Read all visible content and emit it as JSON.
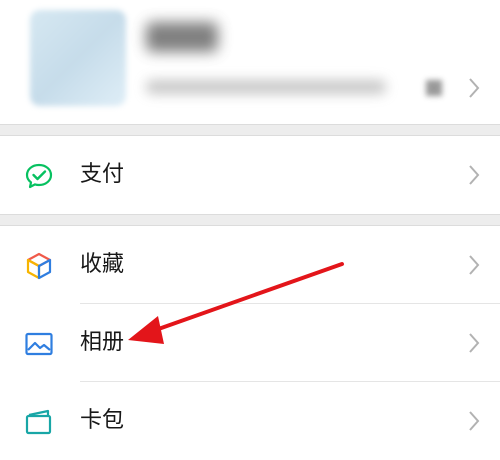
{
  "menu": {
    "items": [
      {
        "label": "支付",
        "icon": "wechat-pay-icon"
      },
      {
        "label": "收藏",
        "icon": "favorites-cube-icon"
      },
      {
        "label": "相册",
        "icon": "album-picture-icon"
      },
      {
        "label": "卡包",
        "icon": "card-wallet-icon"
      }
    ]
  },
  "colors": {
    "pay_green": "#07c160",
    "album_blue": "#2f7ee0",
    "card_teal": "#18a6a6",
    "annotation_red": "#e3151a",
    "chevron": "#b2b2b2",
    "separator_gray": "#ededed"
  }
}
